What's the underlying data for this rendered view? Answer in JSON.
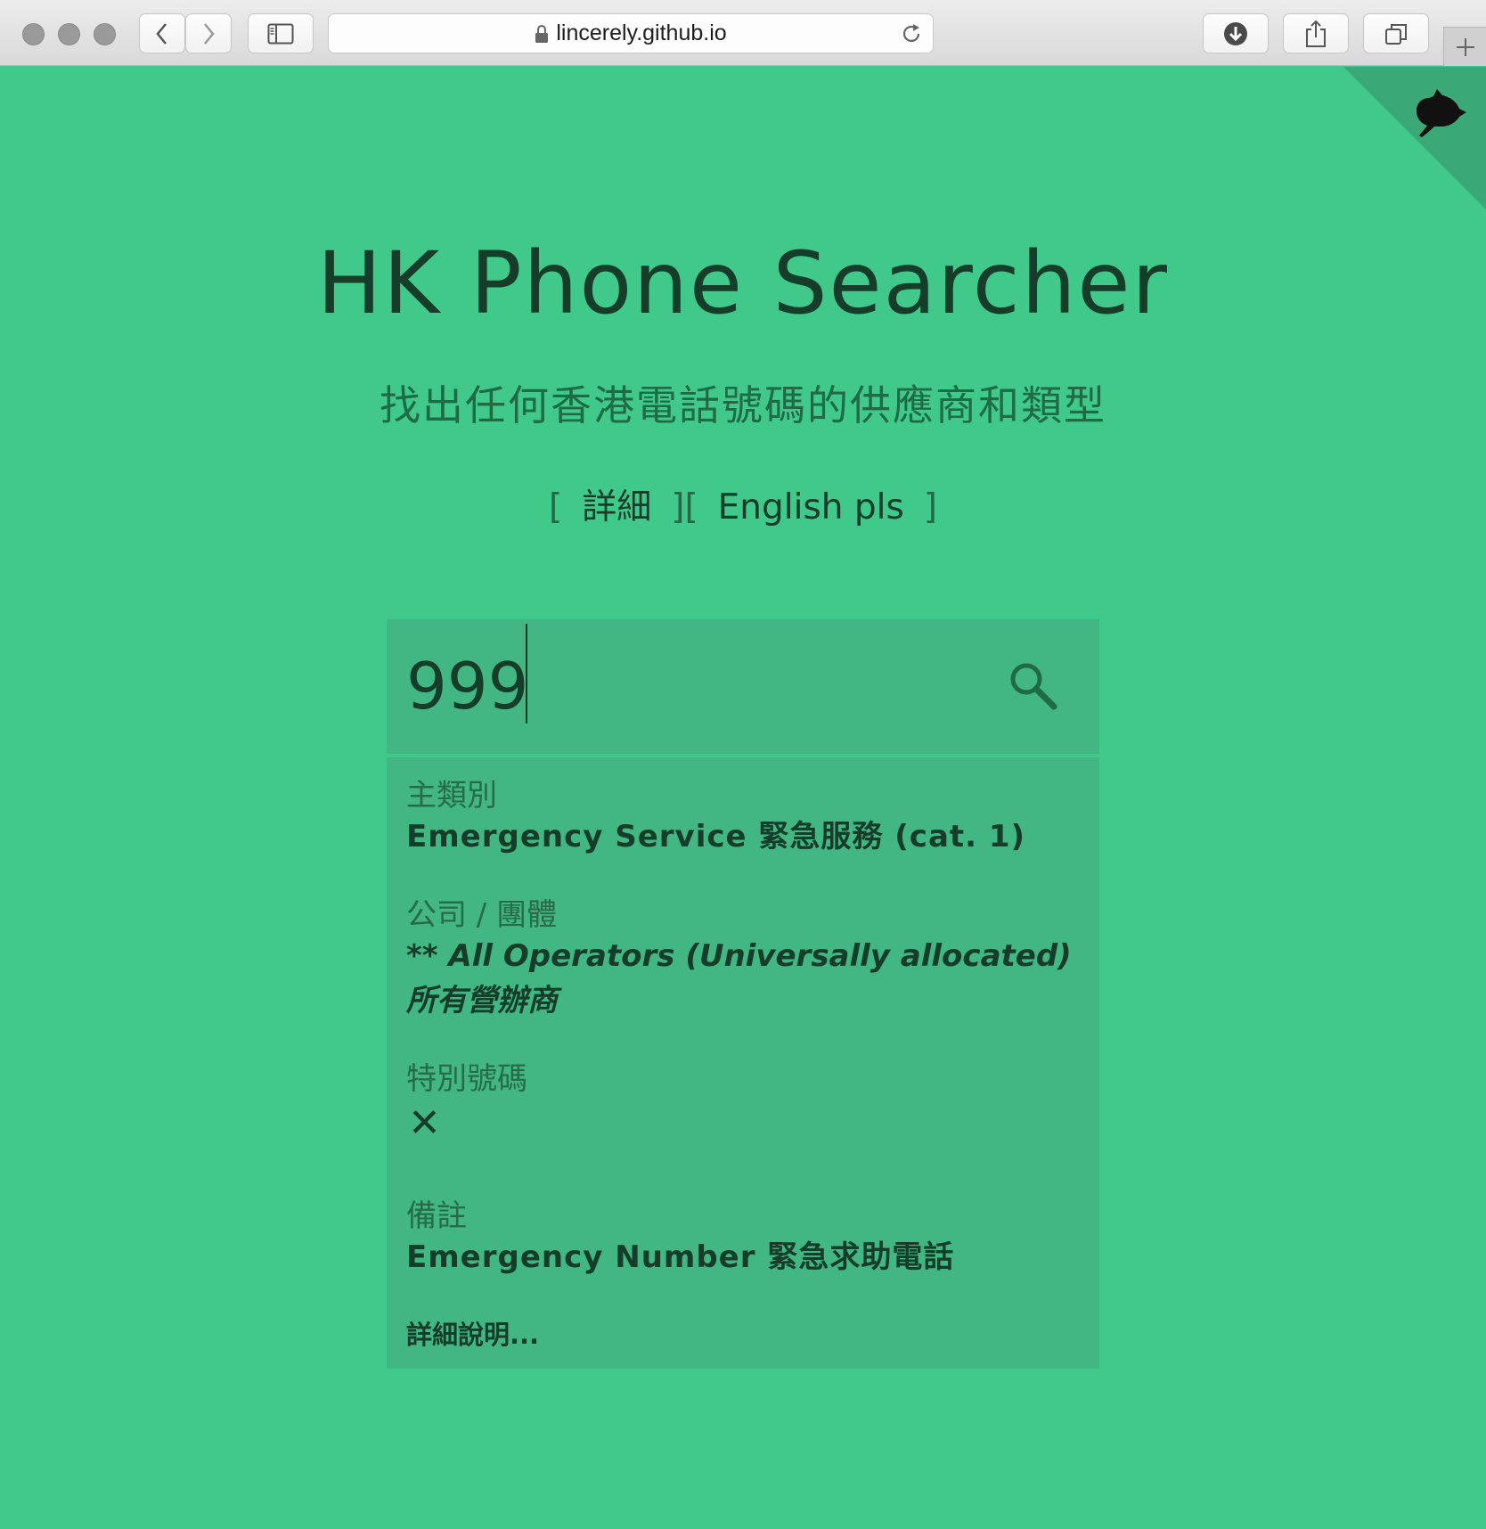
{
  "browser": {
    "url": "lincerely.github.io"
  },
  "header": {
    "title": "HK Phone Searcher",
    "subtitle": "找出任何香港電話號碼的供應商和類型",
    "details_link": "詳細",
    "english_link": "English pls",
    "bracket_open": "[",
    "bracket_close": "]"
  },
  "search": {
    "value": "999"
  },
  "result": {
    "category_label": "主類別",
    "category_value": "Emergency Service 緊急服務 (cat. 1)",
    "company_label": "公司 / 團體",
    "company_value": "** All Operators (Universally allocated) 所有營辦商",
    "special_label": "特別號碼",
    "special_value": "✕",
    "remarks_label": "備註",
    "remarks_value": "Emergency Number 緊急求助電話",
    "more_link": "詳細說明..."
  }
}
